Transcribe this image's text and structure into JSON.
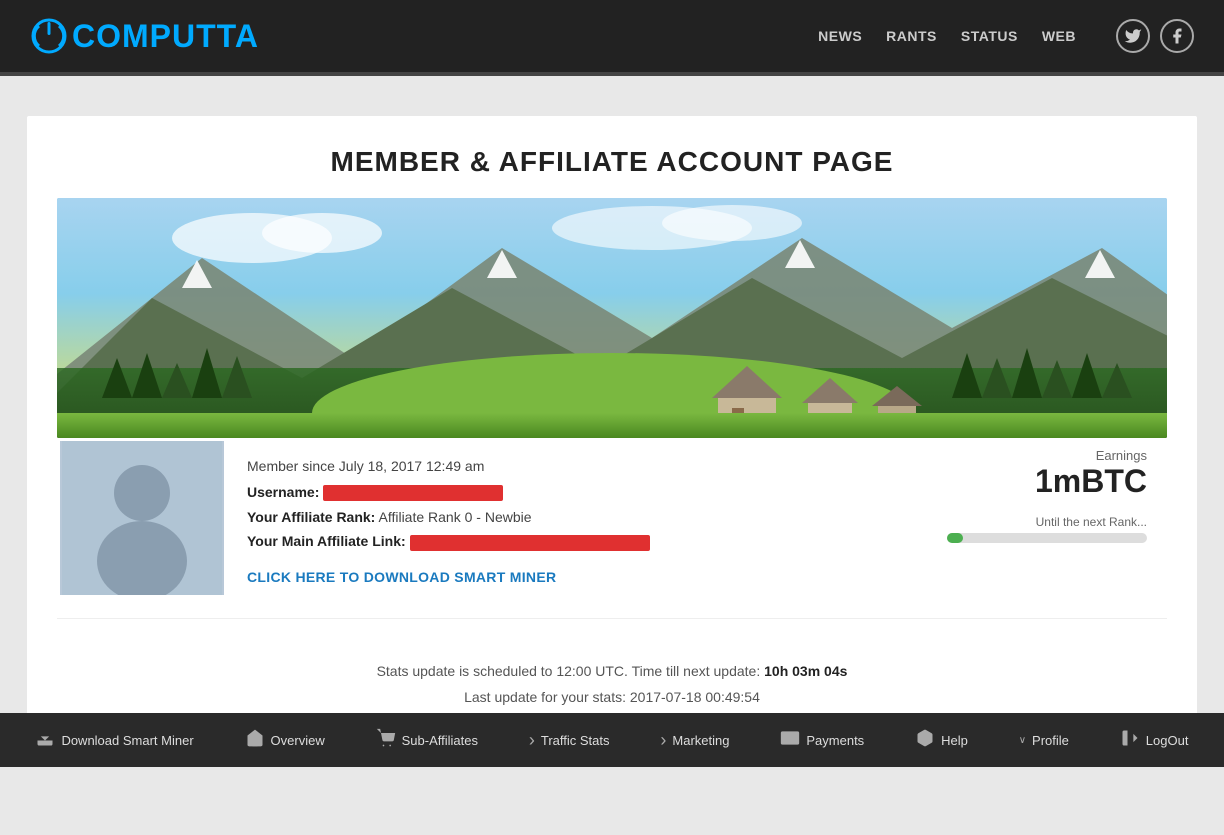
{
  "header": {
    "logo_text": "COMPUTTA",
    "nav_links": [
      {
        "label": "NEWS",
        "id": "news"
      },
      {
        "label": "RANTS",
        "id": "rants"
      },
      {
        "label": "STATUS",
        "id": "status"
      },
      {
        "label": "WEB",
        "id": "web"
      }
    ],
    "social": [
      {
        "icon": "𝕋",
        "name": "twitter"
      },
      {
        "icon": "f",
        "name": "facebook"
      }
    ]
  },
  "page": {
    "title": "MEMBER & AFFILIATE ACCOUNT PAGE"
  },
  "profile": {
    "member_since": "Member since July 18, 2017 12:49 am",
    "username_label": "Username:",
    "affiliate_rank_label": "Your Affiliate Rank:",
    "affiliate_rank_value": "Affiliate Rank 0 - Newbie",
    "main_link_label": "Your Main Affiliate Link:",
    "download_link_text": "CLICK HERE TO DOWNLOAD SMART MINER"
  },
  "earnings": {
    "label": "Earnings",
    "value": "1mBTC",
    "rank_label": "Until the next Rank...",
    "rank_progress": 8
  },
  "stats": {
    "schedule_text": "Stats update is scheduled to 12:00 UTC. Time till next update:",
    "time_remaining": "10h 03m 04s",
    "last_update_text": "Last update for your stats: 2017-07-18 00:49:54"
  },
  "bottom_nav": [
    {
      "icon": "⬇",
      "label": "Download Smart Miner",
      "name": "download"
    },
    {
      "icon": "⌂",
      "label": "Overview",
      "name": "overview"
    },
    {
      "icon": "⋮",
      "label": "Sub-Affiliates",
      "name": "sub-affiliates"
    },
    {
      "icon": "›",
      "label": "Traffic Stats",
      "name": "traffic-stats"
    },
    {
      "icon": "›",
      "label": "Marketing",
      "name": "marketing"
    },
    {
      "icon": "⬡",
      "label": "Payments",
      "name": "payments"
    },
    {
      "icon": "?",
      "label": "Help",
      "name": "help"
    },
    {
      "icon": "∨",
      "label": "Profile",
      "name": "profile"
    },
    {
      "icon": "↗",
      "label": "LogOut",
      "name": "logout"
    }
  ]
}
